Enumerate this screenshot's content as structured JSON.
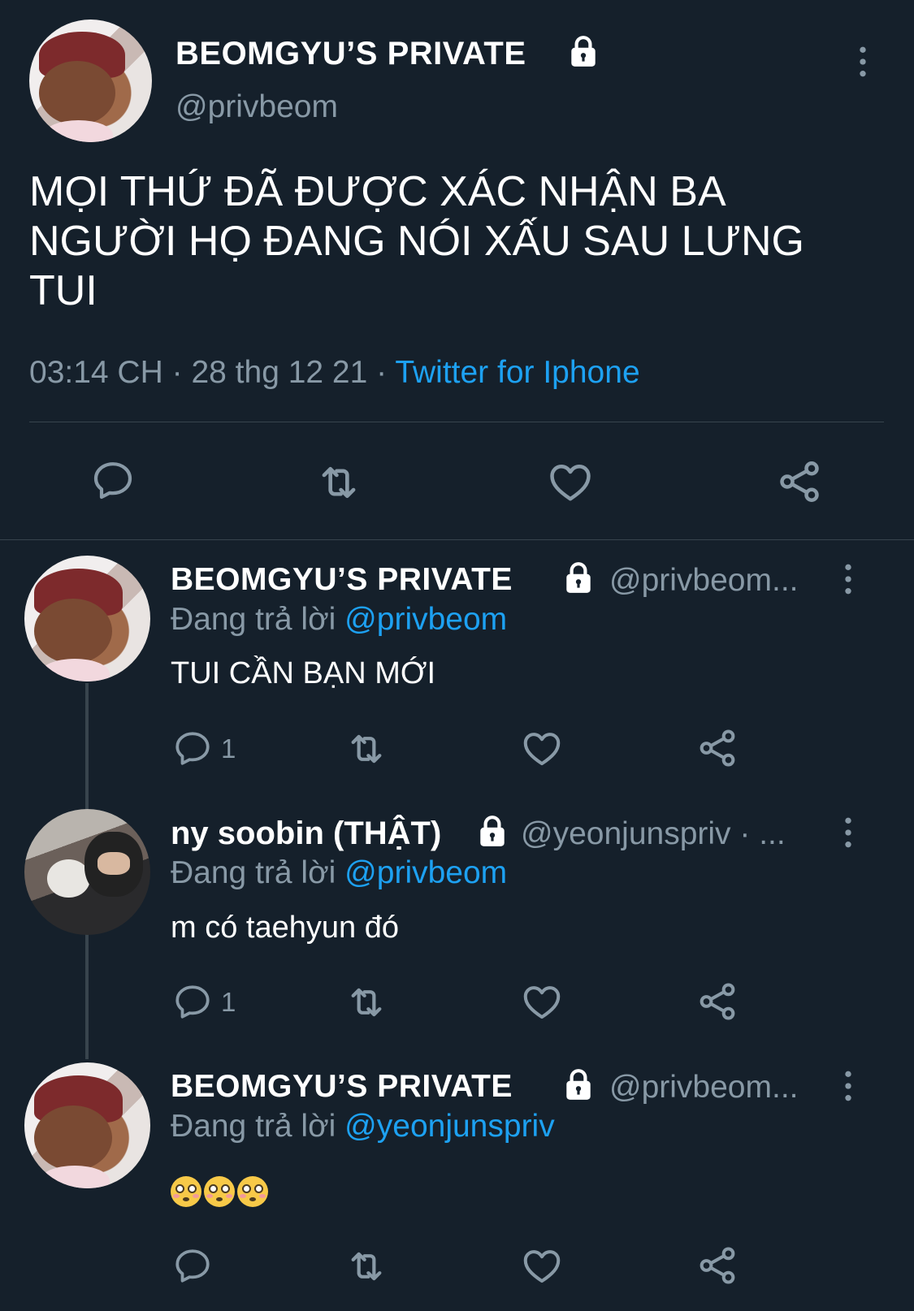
{
  "main_tweet": {
    "display_name": "BEOMGYU’S PRIVATE",
    "handle": "@privbeom",
    "text": "MỌI THỨ ĐÃ ĐƯỢC XÁC NHẬN BA NGƯỜI HỌ ĐANG NÓI XẤU SAU LƯNG TUI",
    "time": "03:14 CH",
    "separator": "·",
    "date": "28 thg 12 21",
    "source": "Twitter for Iphone"
  },
  "replies": [
    {
      "display_name": "BEOMGYU’S PRIVATE",
      "handle": "@privbeom...",
      "replying_label": "Đang trả lời",
      "replying_to": "@privbeom",
      "text": "TUI CẦN BẠN MỚI",
      "reply_count": "1"
    },
    {
      "display_name": "ny soobin (THẬT)",
      "handle": "@yeonjunspriv · ...",
      "replying_label": "Đang trả lời",
      "replying_to": "@privbeom",
      "text": "m có taehyun đó",
      "reply_count": "1"
    },
    {
      "display_name": "BEOMGYU’S PRIVATE",
      "handle": "@privbeom...",
      "replying_label": "Đang trả lời",
      "replying_to": "@yeonjunspriv",
      "emoji_text": "😳😳😳",
      "reply_count": ""
    }
  ],
  "colors": {
    "background": "#15202b",
    "text": "#ffffff",
    "secondary": "#8899a6",
    "accent": "#1da1f2",
    "divider": "#38444d"
  },
  "icons": [
    "lock-icon",
    "more-vertical-icon",
    "reply-icon",
    "retweet-icon",
    "like-icon",
    "share-icon",
    "flushed-face-emoji"
  ]
}
